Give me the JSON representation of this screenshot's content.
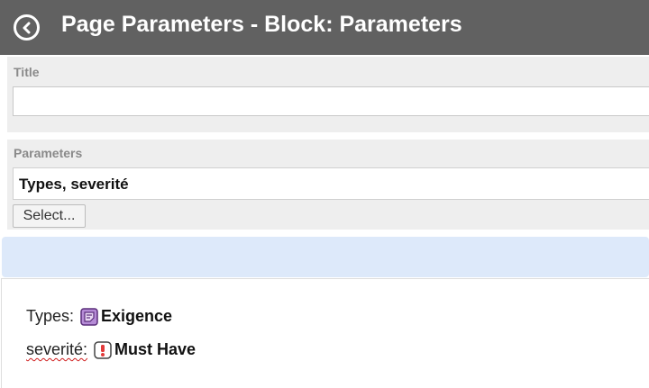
{
  "header": {
    "title": "Page Parameters - Block: Parameters",
    "background": "#616161",
    "back_icon": "arrow-left-circle-icon"
  },
  "title_field": {
    "label": "Title",
    "value": "",
    "placeholder": ""
  },
  "parameters_field": {
    "label": "Parameters",
    "value": "Types, severité",
    "select_label": "Select..."
  },
  "info_bar": {
    "color": "#dde9fa",
    "text": ""
  },
  "preview": {
    "rows": [
      {
        "label": "Types:",
        "icon": "requirement-icon",
        "icon_color": "#b58bd6",
        "value": "Exigence"
      },
      {
        "label": "severité:",
        "icon": "exclamation-icon",
        "icon_color": "#e23b3b",
        "value": "Must Have"
      }
    ]
  }
}
